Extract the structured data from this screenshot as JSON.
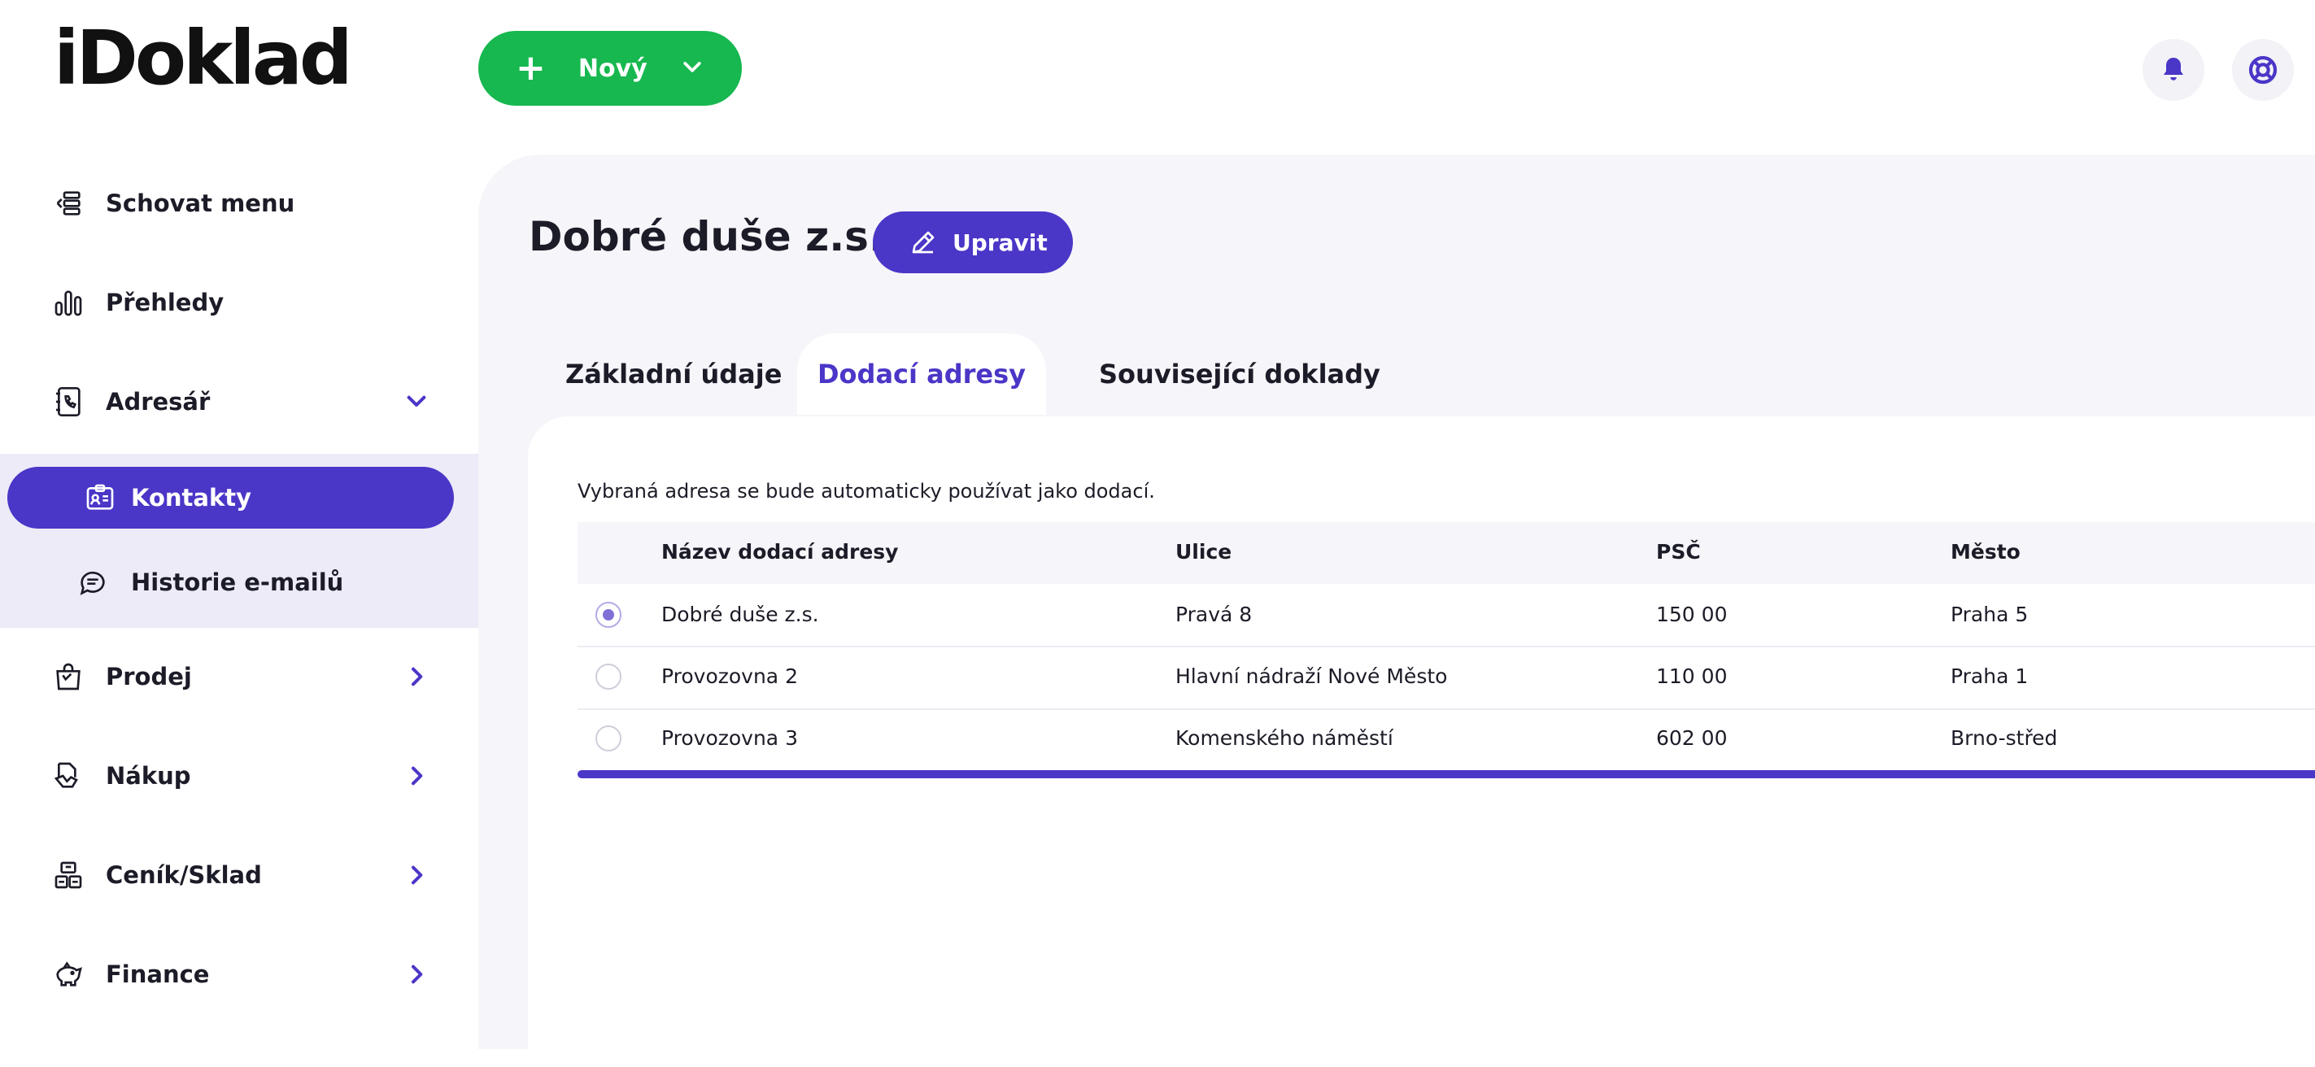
{
  "header": {
    "logo_text": "iDoklad",
    "new_button_label": "Nový"
  },
  "sidebar": {
    "items": [
      {
        "label": "Schovat menu",
        "icon": "collapse-menu-icon"
      },
      {
        "label": "Přehledy",
        "icon": "bar-chart-icon"
      },
      {
        "label": "Adresář",
        "icon": "address-book-icon",
        "expanded": true
      },
      {
        "label": "Kontakty",
        "icon": "contact-card-icon",
        "active": true
      },
      {
        "label": "Historie e-mailů",
        "icon": "chat-history-icon"
      },
      {
        "label": "Prodej",
        "icon": "shopping-bag-icon"
      },
      {
        "label": "Nákup",
        "icon": "purchase-icon"
      },
      {
        "label": "Ceník/Sklad",
        "icon": "warehouse-icon"
      },
      {
        "label": "Finance",
        "icon": "piggy-bank-icon"
      }
    ]
  },
  "main": {
    "title": "Dobré duše z.s.",
    "edit_button_label": "Upravit",
    "tabs": [
      {
        "label": "Základní údaje"
      },
      {
        "label": "Dodací adresy",
        "active": true
      },
      {
        "label": "Související doklady"
      }
    ],
    "hint": "Vybraná adresa se bude automaticky používat jako dodací.",
    "table": {
      "columns": [
        "Název dodací adresy",
        "Ulice",
        "PSČ",
        "Město"
      ],
      "rows": [
        {
          "selected": true,
          "name": "Dobré duše z.s.",
          "street": "Pravá 8",
          "zip": "150 00",
          "city": "Praha 5"
        },
        {
          "selected": false,
          "name": "Provozovna 2",
          "street": "Hlavní nádraží Nové Město",
          "zip": "110 00",
          "city": "Praha 1"
        },
        {
          "selected": false,
          "name": "Provozovna 3",
          "street": "Komenského náměstí",
          "zip": "602 00",
          "city": "Brno-střed"
        }
      ]
    }
  },
  "colors": {
    "accent": "#4a36c7",
    "new_button": "#17b84f",
    "panel_bg": "#f6f5fa",
    "submenu_bg": "#ecebf7"
  }
}
